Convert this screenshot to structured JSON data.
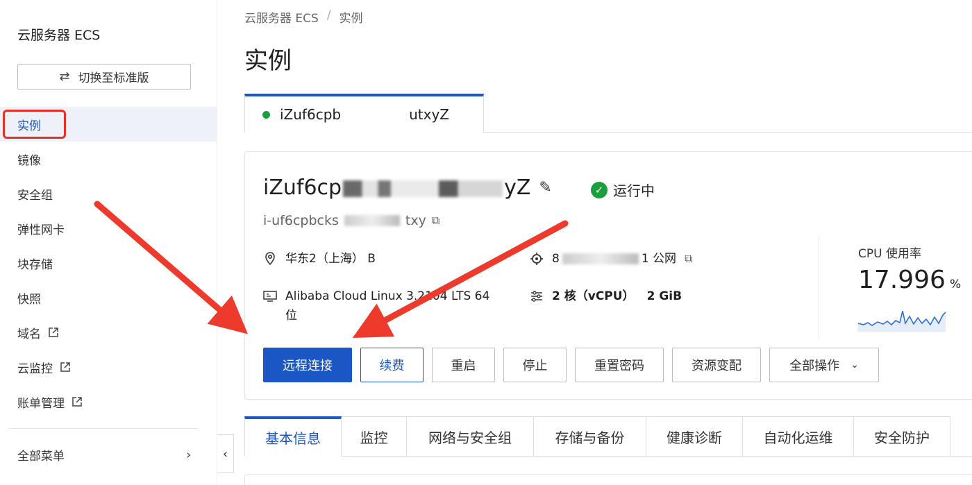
{
  "sidebar": {
    "title": "云服务器 ECS",
    "switch_label": "切换至标准版",
    "items": [
      {
        "label": "实例",
        "active": true
      },
      {
        "label": "镜像"
      },
      {
        "label": "安全组"
      },
      {
        "label": "弹性网卡"
      },
      {
        "label": "块存储"
      },
      {
        "label": "快照"
      },
      {
        "label": "域名",
        "external": true
      },
      {
        "label": "云监控",
        "external": true
      },
      {
        "label": "账单管理",
        "external": true
      }
    ],
    "all_menu": "全部菜单"
  },
  "breadcrumb": {
    "parent": "云服务器 ECS",
    "sep": "/",
    "current": "实例"
  },
  "page_title": "实例",
  "instance_tab": {
    "label_start": "iZuf6cpb",
    "label_end": "utxyZ"
  },
  "instance": {
    "name_start": "iZuf6cp",
    "name_end": "yZ",
    "status": "运行中",
    "id_start": "i-uf6cpbcks",
    "id_end": "txy",
    "region": "华东2（上海） B",
    "ip_start": "8",
    "ip_end": "1",
    "ip_type": "公网",
    "os_line1": "Alibaba Cloud Linux 3.2104 LTS 64",
    "os_line2": "位",
    "cpu_cores": "2 核（vCPU）",
    "memory": "2 GiB"
  },
  "cpu": {
    "label": "CPU 使用率",
    "value": "17.996",
    "unit": "%"
  },
  "actions": {
    "remote": "远程连接",
    "renew": "续费",
    "restart": "重启",
    "stop": "停止",
    "reset_password": "重置密码",
    "resize": "资源变配",
    "all_ops": "全部操作"
  },
  "detail_tabs": [
    "基本信息",
    "监控",
    "网络与安全组",
    "存储与备份",
    "健康诊断",
    "自动化运维",
    "安全防护"
  ],
  "colors": {
    "primary": "#1a57c4",
    "running": "#1b9e3e",
    "annotation": "#e63024"
  }
}
